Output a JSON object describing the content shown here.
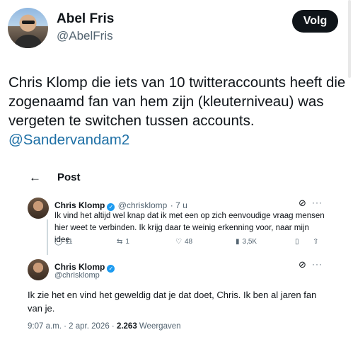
{
  "author": {
    "name": "Abel Fris",
    "handle": "@AbelFris",
    "follow_label": "Volg"
  },
  "tweet": {
    "text": "Chris Klomp die iets van 10 twitteraccounts heeft die zogenaamd fan van hem zijn (kleuterniveau) was vergeten te switchen tussen accounts.",
    "mention": "@Sandervandam2"
  },
  "embed": {
    "back_icon": "←",
    "title": "Post",
    "reply": {
      "name": "Chris Klomp",
      "handle": "@chrisklomp",
      "time": "· 7 u",
      "text": "Ik vind het altijd wel knap dat ik met een op zich eenvoudige vraag mensen hier weet te verbinden. Ik krijg daar te weinig erkenning voor, naar mijn idee.",
      "stats": {
        "replies": "11",
        "reposts": "1",
        "likes": "48",
        "views": "3,5K"
      }
    },
    "main": {
      "name": "Chris Klomp",
      "handle": "@chrisklomp",
      "text": "Ik zie het en vind het geweldig dat je dat doet, Chris. Ik ben al jaren fan van je.",
      "timestamp": "9:07 a.m. · 2 apr. 2026 · ",
      "views_count": "2.263",
      "views_label": " Weergaven"
    }
  },
  "colors": {
    "accent": "#1d9bf0",
    "mention": "#1d6fa5",
    "text": "#0f1419",
    "muted": "#536471"
  }
}
